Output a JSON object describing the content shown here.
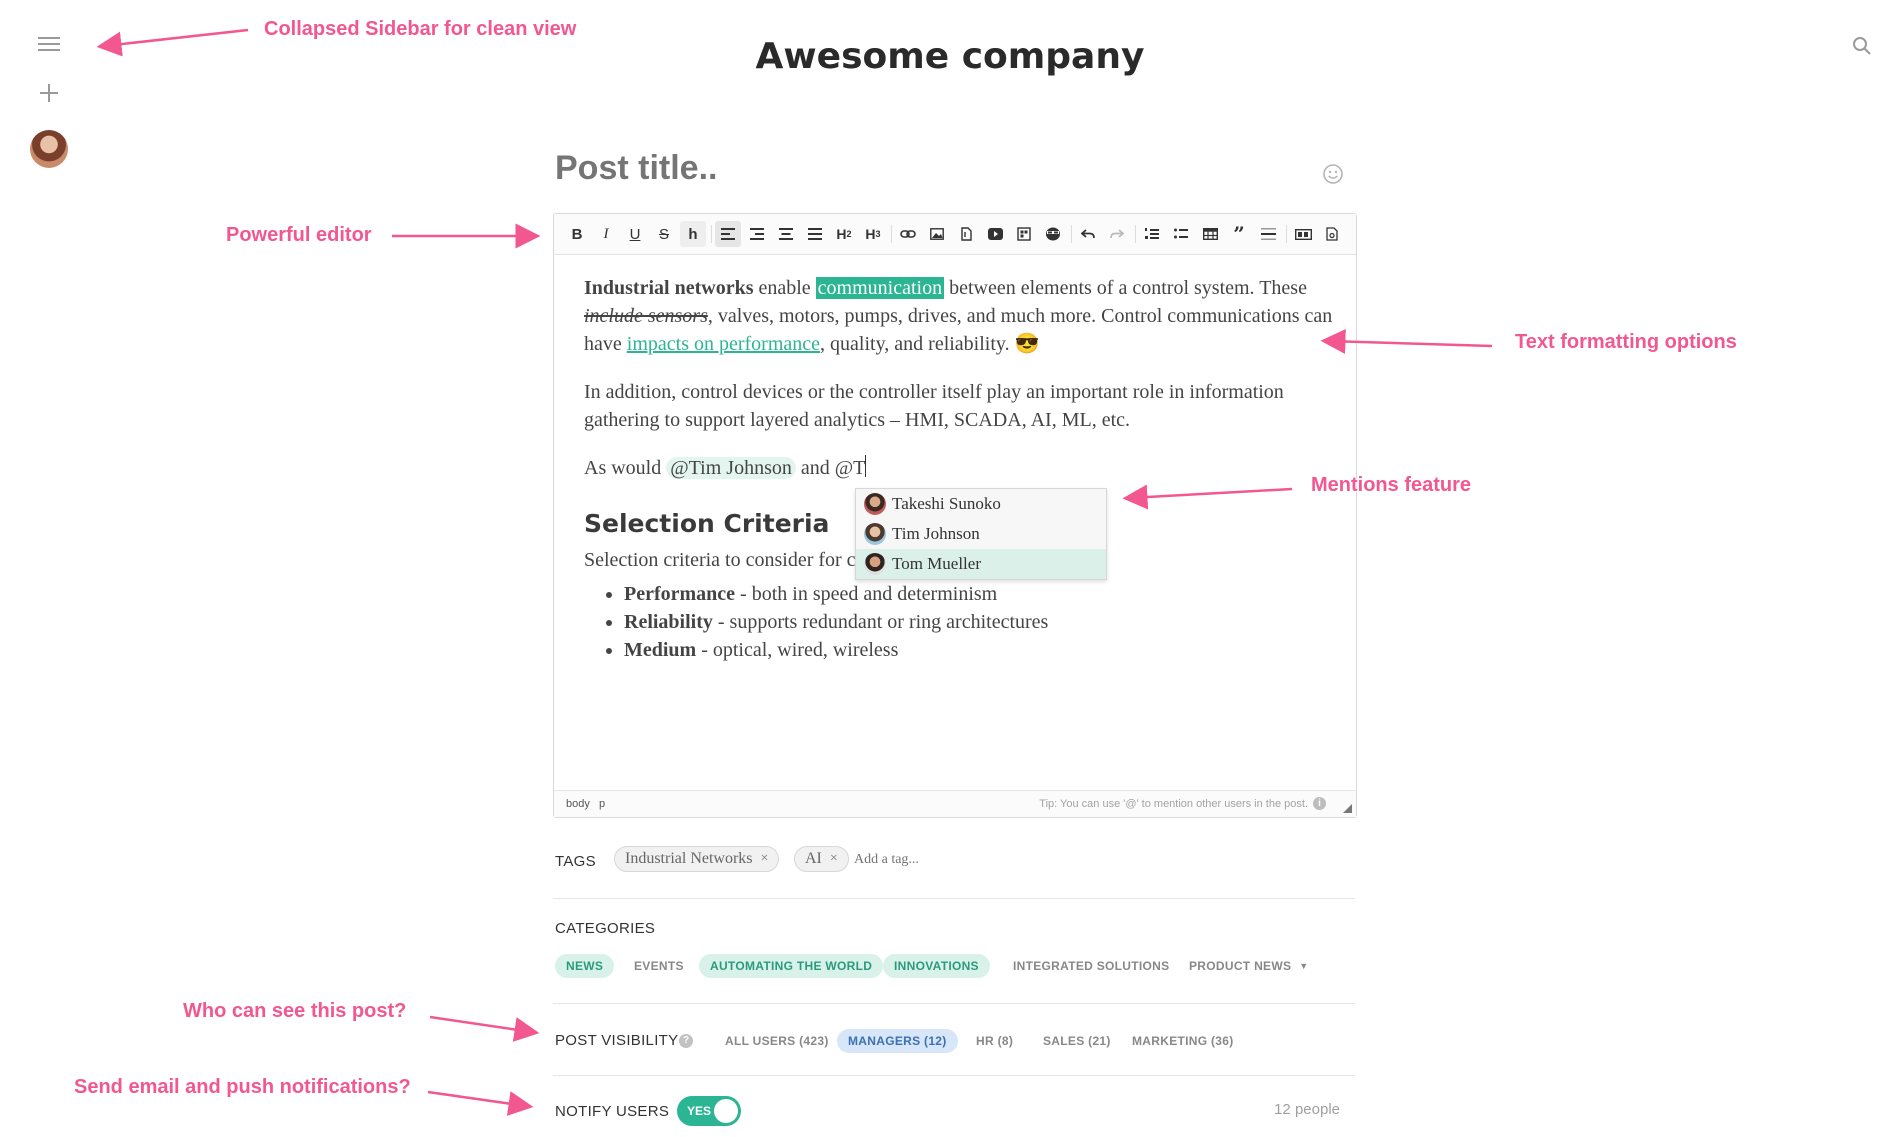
{
  "company": {
    "title": "Awesome company"
  },
  "post": {
    "title_placeholder": "Post title.."
  },
  "editor": {
    "p1": {
      "bold": "Industrial networks",
      "t1": " enable ",
      "highlight": "communication",
      "t2": " between elements of a control system. These ",
      "strike": "include sensors",
      "t3": ", valves, motors, pumps, drives, and much more. Control communications can have ",
      "link": "impacts on performance",
      "t4": ", quality, and reliability. ",
      "emoji": "😎"
    },
    "p2": "In addition, control devices or the controller itself play an important role in information gathering to support layered analytics – HMI, SCADA, AI, ML, etc.",
    "p3": {
      "prefix": "As would ",
      "mention": "@Tim Johnson",
      "middle": " and ",
      "typing": "@T"
    },
    "heading": "Selection Criteria",
    "p4": "Selection criteria to consider for choosing an industrial network:",
    "bullets": [
      {
        "term": "Performance",
        "desc": " - both in speed and determinism"
      },
      {
        "term": "Reliability",
        "desc": " - supports redundant or ring architectures"
      },
      {
        "term": "Medium",
        "desc": " - optical, wired, wireless"
      }
    ],
    "mention_suggestions": [
      "Takeshi Sunoko",
      "Tim Johnson",
      "Tom Mueller"
    ],
    "statusbar": {
      "path_body": "body",
      "path_p": "p",
      "tip": "Tip: You can use '@' to mention other users in the post."
    }
  },
  "tags": {
    "label": "TAGS",
    "items": [
      "Industrial Networks",
      "AI"
    ],
    "placeholder": "Add a tag..."
  },
  "categories": {
    "label": "CATEGORIES",
    "items": [
      {
        "label": "NEWS",
        "selected": true
      },
      {
        "label": "EVENTS",
        "selected": false
      },
      {
        "label": "AUTOMATING THE WORLD",
        "selected": true
      },
      {
        "label": "INNOVATIONS",
        "selected": true
      },
      {
        "label": "INTEGRATED SOLUTIONS",
        "selected": false
      },
      {
        "label": "PRODUCT NEWS",
        "selected": false
      }
    ]
  },
  "visibility": {
    "label": "POST VISIBILITY",
    "items": [
      {
        "label": "ALL USERS (423)",
        "selected": false
      },
      {
        "label": "MANAGERS (12)",
        "selected": true
      },
      {
        "label": "HR (8)",
        "selected": false
      },
      {
        "label": "SALES (21)",
        "selected": false
      },
      {
        "label": "MARKETING (36)",
        "selected": false
      }
    ]
  },
  "notify": {
    "label": "NOTIFY USERS",
    "toggle": "YES",
    "count": "12 people"
  },
  "annotations": {
    "sidebar": "Collapsed Sidebar for clean view",
    "editor": "Powerful editor",
    "formatting": "Text formatting options",
    "mentions": "Mentions feature",
    "visibility": "Who can see this post?",
    "notify": "Send email and push notifications?"
  },
  "colors": {
    "accent": "#2bb593",
    "annotation": "#f2578f",
    "visibility_selected": "#d7e6f8"
  }
}
